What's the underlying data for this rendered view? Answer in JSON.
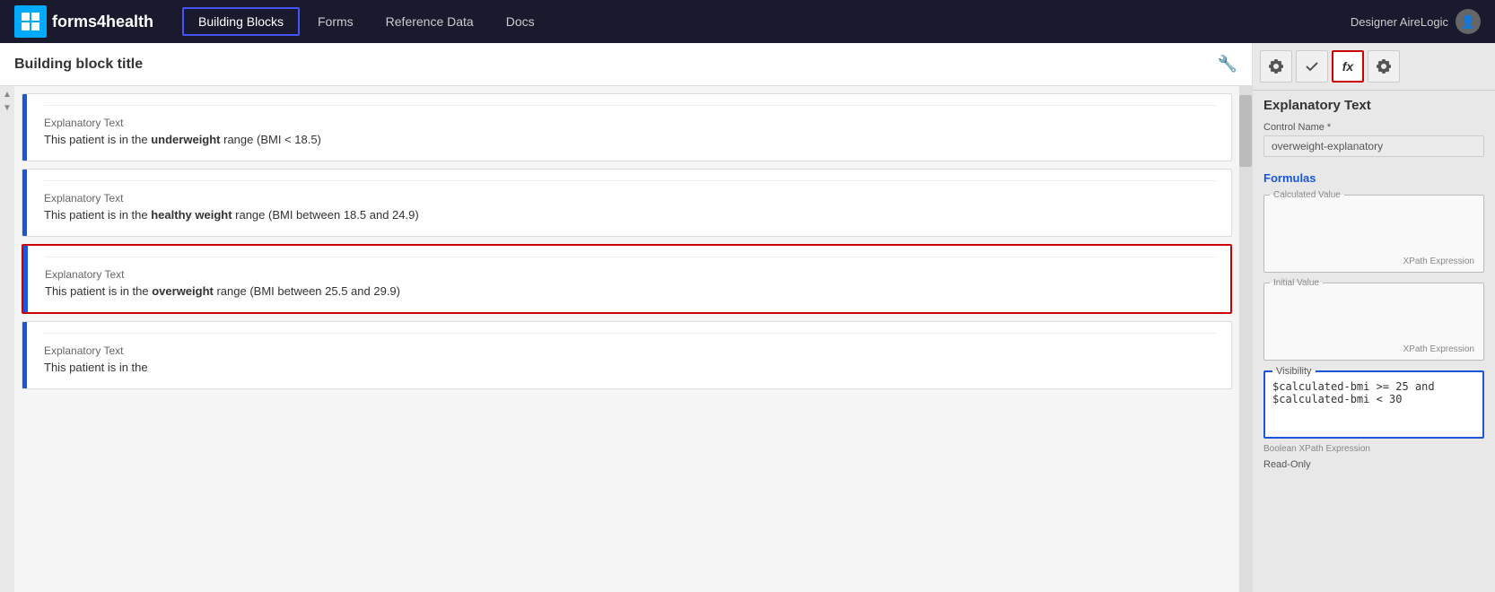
{
  "nav": {
    "logo_text1": "forms",
    "logo_text2": "4health",
    "items": [
      {
        "label": "Building Blocks",
        "active": true
      },
      {
        "label": "Forms",
        "active": false
      },
      {
        "label": "Reference Data",
        "active": false
      },
      {
        "label": "Docs",
        "active": false
      }
    ],
    "user_name": "Designer AireLogic"
  },
  "left_panel": {
    "title": "Building block title",
    "wrench": "⚙"
  },
  "blocks": [
    {
      "id": "block1",
      "label": "Explanatory Text",
      "text_before": "This patient is in the ",
      "text_bold": "underweight",
      "text_after": " range (BMI < 18.5)",
      "selected": false
    },
    {
      "id": "block2",
      "label": "Explanatory Text",
      "text_before": "This patient is in the ",
      "text_bold": "healthy weight",
      "text_after": " range (BMI between 18.5 and 24.9)",
      "selected": false
    },
    {
      "id": "block3",
      "label": "Explanatory Text",
      "text_before": "This patient is in the ",
      "text_bold": "overweight",
      "text_after": " range (BMI between 25.5 and 29.9)",
      "selected": true
    },
    {
      "id": "block4",
      "label": "Explanatory Text",
      "text_before": "This patient is in the ",
      "text_bold": "",
      "text_after": "",
      "selected": false
    }
  ],
  "right_panel": {
    "toolbar_buttons": [
      {
        "label": "⚙",
        "name": "settings-btn",
        "active": false
      },
      {
        "label": "✓",
        "name": "check-btn",
        "active": false
      },
      {
        "label": "fx",
        "name": "formula-btn",
        "active": true
      },
      {
        "label": "⚙",
        "name": "config-btn",
        "active": false
      }
    ],
    "section_title": "Explanatory Text",
    "control_name_label": "Control Name *",
    "control_name_value": "overweight-explanatory",
    "formulas_label": "Formulas",
    "calculated_value_label": "Calculated Value",
    "xpath_expr_label": "XPath Expression",
    "initial_value_label": "Initial Value",
    "visibility_label": "Visibility",
    "visibility_value": "$calculated-bmi >= 25 and\n$calculated-bmi < 30",
    "boolean_xpath_label": "Boolean XPath Expression",
    "readonly_label": "Read-Only"
  }
}
